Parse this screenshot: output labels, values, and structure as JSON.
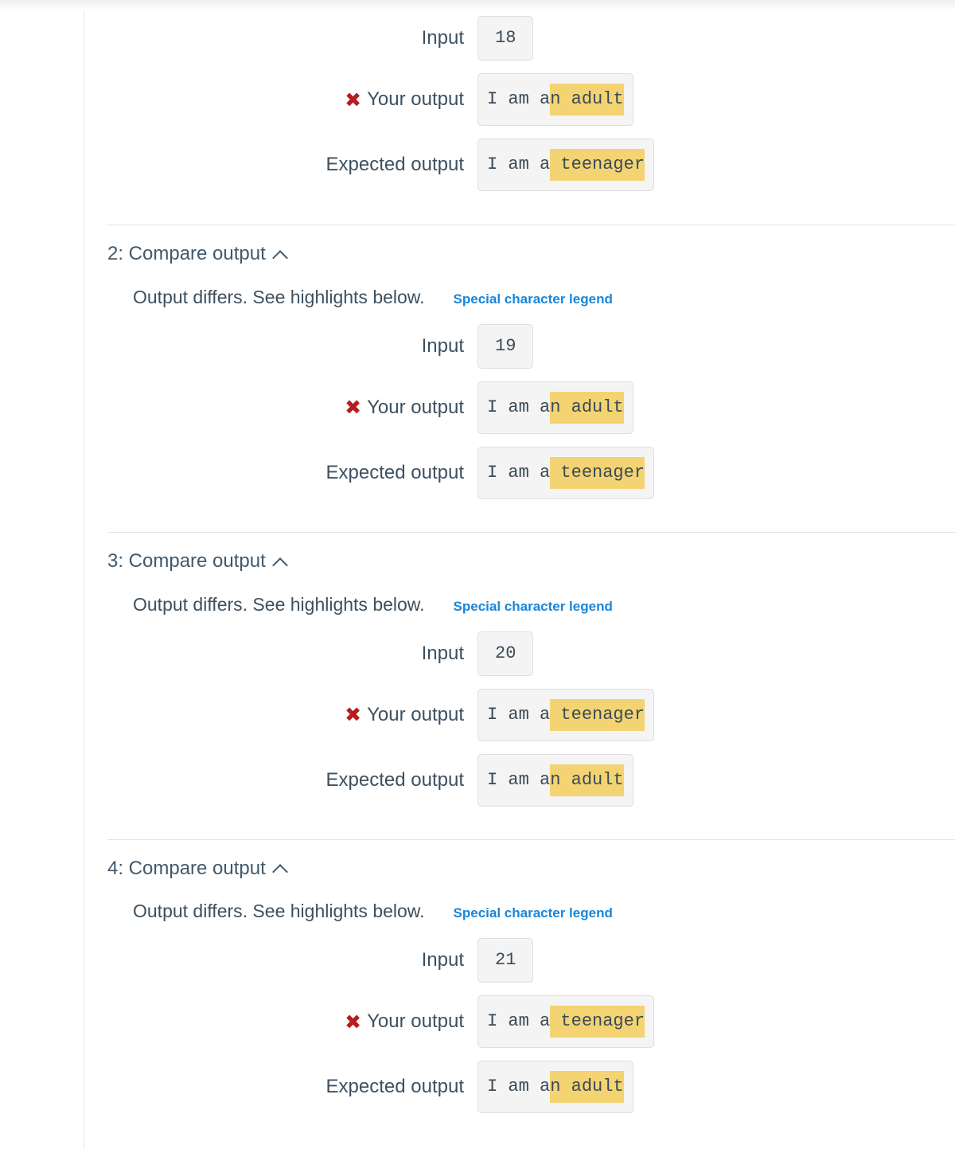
{
  "common": {
    "differs_text": "Output differs. See highlights below.",
    "legend_link": "Special character legend",
    "input_label": "Input",
    "your_output_label": "Your output",
    "expected_output_label": "Expected output",
    "fail_mark": "✖",
    "chevron": "collapse-chevron-up"
  },
  "colors": {
    "header_text": "#41596b",
    "body_text": "#3d5060",
    "link": "#1a86d9",
    "fail_red": "#b81c1c",
    "highlight": "#f3d372",
    "box_bg": "#f4f4f4",
    "box_border": "#dedede",
    "divider": "#e4e4e4"
  },
  "sections": [
    {
      "id": "section-1-partial",
      "title": null,
      "partial_top": true,
      "input": "18",
      "your_output": {
        "plain": "I am a",
        "highlight": "n adult"
      },
      "expected_output": {
        "plain": "I am a",
        "highlight": " teenager"
      }
    },
    {
      "id": "section-2",
      "title": "2: Compare output",
      "input": "19",
      "your_output": {
        "plain": "I am a",
        "highlight": "n adult"
      },
      "expected_output": {
        "plain": "I am a",
        "highlight": " teenager"
      }
    },
    {
      "id": "section-3",
      "title": "3: Compare output",
      "input": "20",
      "your_output": {
        "plain": "I am a",
        "highlight": " teenager"
      },
      "expected_output": {
        "plain": "I am a",
        "highlight": "n adult"
      }
    },
    {
      "id": "section-4",
      "title": "4: Compare output",
      "input": "21",
      "your_output": {
        "plain": "I am a",
        "highlight": " teenager"
      },
      "expected_output": {
        "plain": "I am a",
        "highlight": "n adult"
      }
    }
  ]
}
